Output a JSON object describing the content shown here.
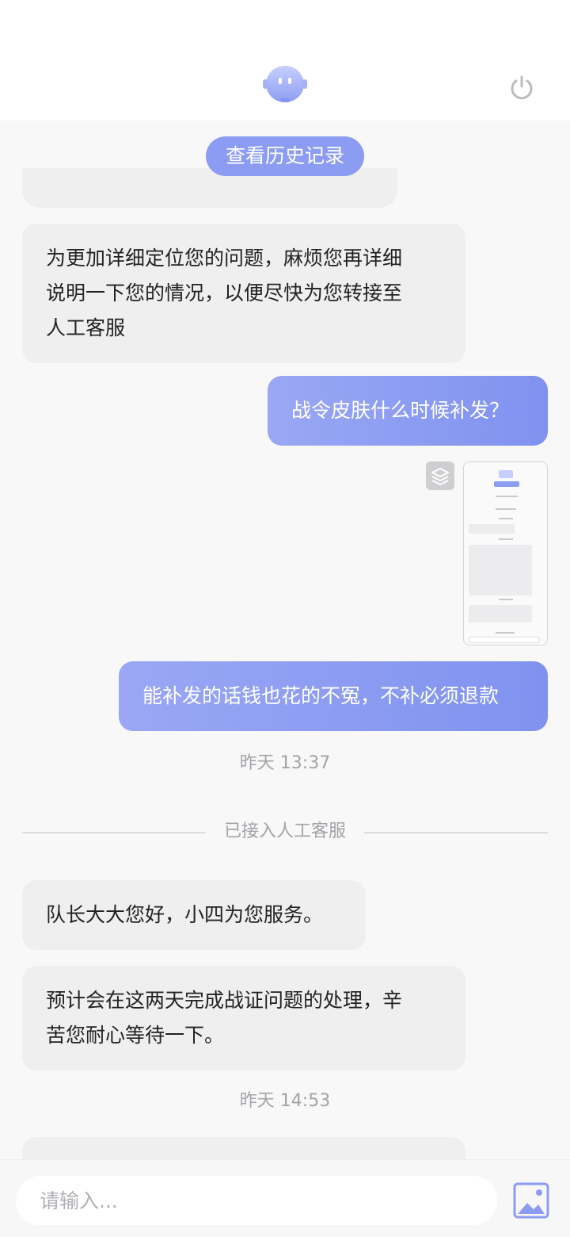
{
  "history_button": "查看历史记录",
  "messages": {
    "bot_prompt_lines": [
      "为更加详细定位您的问题，麻烦您再详细",
      "说明一下您的情况，以便尽快为您转接至",
      "人工客服"
    ],
    "user_q1": "战令皮肤什么时候补发？",
    "user_q2": "能补发的话钱也花的不冤，不补必须退款",
    "time1": "昨天 13:37",
    "divider": "已接入人工客服",
    "agent_greeting": "队长大大您好，小四为您服务。",
    "agent_reply_lines": [
      "预计会在这两天完成战证问题的处理，辛",
      "苦您耐心等待一下。"
    ],
    "time2": "昨天 14:53"
  },
  "input": {
    "placeholder": "请输入..."
  },
  "colors": {
    "accent": "#8c9cf2",
    "user_bubble_start": "#9aa7f4",
    "user_bubble_end": "#7f92ef",
    "bot_bubble": "#efeff0"
  },
  "icons": {
    "avatar": "robot-avatar-icon",
    "power": "power-icon",
    "stack": "layers-icon",
    "image": "image-icon"
  }
}
